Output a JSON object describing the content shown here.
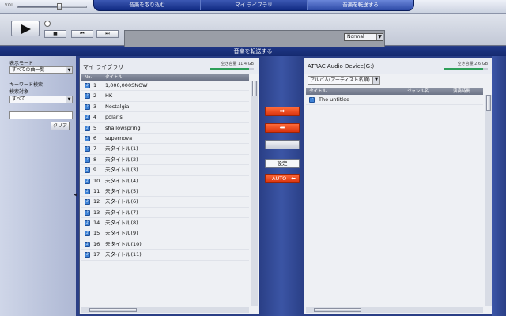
{
  "topbar": {
    "vol_label": "VOL",
    "volume_level": 0.6,
    "tabs": [
      {
        "label": "音楽を取り込む",
        "active": false
      },
      {
        "label": "マイ ライブラリ",
        "active": false
      },
      {
        "label": "音楽を転送する",
        "active": true
      }
    ]
  },
  "player": {
    "prev_label": "⏮",
    "next_label": "⏭",
    "stop_label": "■",
    "play_mode": "Normal",
    "select_arrow": "▼"
  },
  "transfer": {
    "title": "音楽を転送する",
    "settings_label": "設定",
    "auto_label": "AUTO",
    "auto_arrow": "⬅"
  },
  "sidepanel": {
    "display_mode_label": "表示モード",
    "display_mode_value": "すべての曲一覧",
    "keyword_label": "キーワード検索",
    "search_target_label": "検索対象",
    "search_target_value": "すべて",
    "clear_label": "クリア",
    "select_arrow": "▼",
    "collapse_arrow": "◀"
  },
  "library": {
    "title": "マイ ライブラリ",
    "capacity": "空き容量 11.4 GB",
    "capacity_fraction": 0.9,
    "columns": {
      "no": "No.",
      "title": "タイトル"
    },
    "rows": [
      {
        "no": "1",
        "title": "1,000,000SNOW"
      },
      {
        "no": "2",
        "title": "HK"
      },
      {
        "no": "3",
        "title": "Nostalgia"
      },
      {
        "no": "4",
        "title": "polaris"
      },
      {
        "no": "5",
        "title": "shallowspring"
      },
      {
        "no": "6",
        "title": "supernova"
      },
      {
        "no": "7",
        "title": "未タイトル(1)"
      },
      {
        "no": "8",
        "title": "未タイトル(2)"
      },
      {
        "no": "9",
        "title": "未タイトル(3)"
      },
      {
        "no": "10",
        "title": "未タイトル(4)"
      },
      {
        "no": "11",
        "title": "未タイトル(5)"
      },
      {
        "no": "12",
        "title": "未タイトル(6)"
      },
      {
        "no": "13",
        "title": "未タイトル(7)"
      },
      {
        "no": "14",
        "title": "未タイトル(8)"
      },
      {
        "no": "15",
        "title": "未タイトル(9)"
      },
      {
        "no": "16",
        "title": "未タイトル(10)"
      },
      {
        "no": "17",
        "title": "未タイトル(11)"
      }
    ]
  },
  "device": {
    "title": "ATRAC Audio Device(G:)",
    "capacity": "空き容量 2.6 GB",
    "capacity_fraction": 0.9,
    "view_select": "アルバム(アーティスト名順)",
    "select_arrow": "▼",
    "columns": {
      "title": "タイトル",
      "genre": "ジャンル名",
      "duration": "演奏時間"
    },
    "rows": [
      {
        "title": "The untitled"
      }
    ]
  },
  "colors": {
    "accent": "#1f3786",
    "transfer_button": "#e84a1c",
    "capacity_bar": "#2e9f59"
  }
}
